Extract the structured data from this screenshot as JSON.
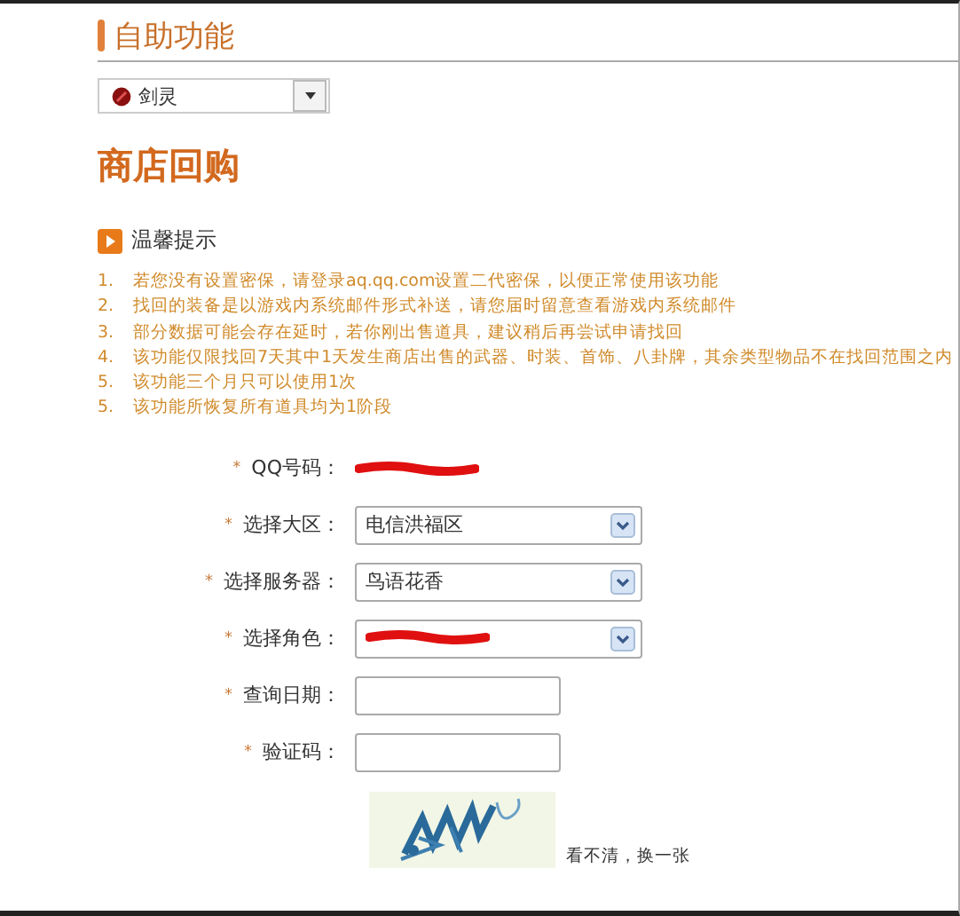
{
  "header": {
    "title": "自助功能"
  },
  "game_select": {
    "value": "剑灵"
  },
  "page_title": "商店回购",
  "tips": {
    "title": "温馨提示",
    "items": [
      {
        "number": "1.",
        "text": "若您没有设置密保，请登录aq.qq.com设置二代密保，以便正常使用该功能"
      },
      {
        "number": "2.",
        "text": "找回的装备是以游戏内系统邮件形式补送，请您届时留意查看游戏内系统邮件"
      },
      {
        "number": "3.",
        "text": "部分数据可能会存在延时，若你刚出售道具，建议稍后再尝试申请找回"
      },
      {
        "number": "4.",
        "text": "该功能仅限找回7天其中1天发生商店出售的武器、时装、首饰、八卦牌，其余类型物品不在找回范围之内"
      },
      {
        "number": "5.",
        "text": "该功能三个月只可以使用1次"
      },
      {
        "number": "5.",
        "text": "该功能所恢复所有道具均为1阶段"
      }
    ]
  },
  "form": {
    "fields": [
      {
        "kind": "redacted",
        "required": "*",
        "label": "QQ号码："
      },
      {
        "kind": "select",
        "required": "*",
        "label": "选择大区：",
        "value": "电信洪福区"
      },
      {
        "kind": "select",
        "required": "*",
        "label": "选择服务器：",
        "value": "鸟语花香"
      },
      {
        "kind": "select-redacted",
        "required": "*",
        "label": "选择角色："
      },
      {
        "kind": "input",
        "required": "*",
        "label": "查询日期："
      },
      {
        "kind": "input",
        "required": "*",
        "label": "验证码："
      }
    ],
    "captcha": {
      "kind": "picture",
      "refresh_link": "看不清，换一张"
    }
  }
}
